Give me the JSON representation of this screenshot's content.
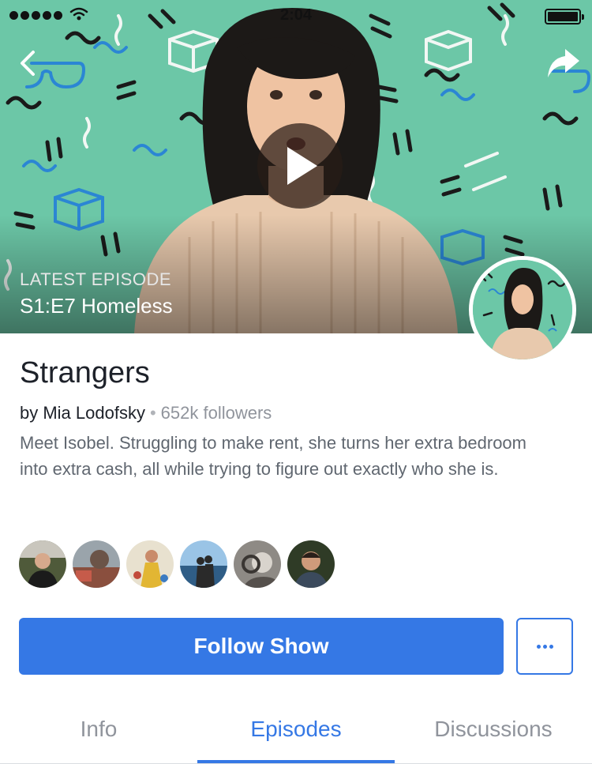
{
  "status_bar": {
    "time": "2:04"
  },
  "hero": {
    "latest_label": "LATEST EPISODE",
    "latest_title": "S1:E7 Homeless"
  },
  "show": {
    "title": "Strangers",
    "author": "by Mia Lodofsky",
    "separator": "•",
    "followers": "652k followers",
    "description": "Meet Isobel. Struggling to make rent, she turns her extra bedroom into extra cash, all while trying to figure out exactly who she is."
  },
  "friends_count_shown": 6,
  "actions": {
    "follow_label": "Follow Show"
  },
  "tabs": [
    {
      "label": "Info",
      "active": false
    },
    {
      "label": "Episodes",
      "active": true
    },
    {
      "label": "Discussions",
      "active": false
    }
  ],
  "colors": {
    "accent": "#3578e5",
    "hero_background": "#6cc7a7",
    "muted_text": "#90949c"
  },
  "icons": [
    "back-arrow-icon",
    "share-arrow-icon",
    "play-icon",
    "more-dots-icon",
    "wifi-icon",
    "battery-icon",
    "signal-icon"
  ]
}
